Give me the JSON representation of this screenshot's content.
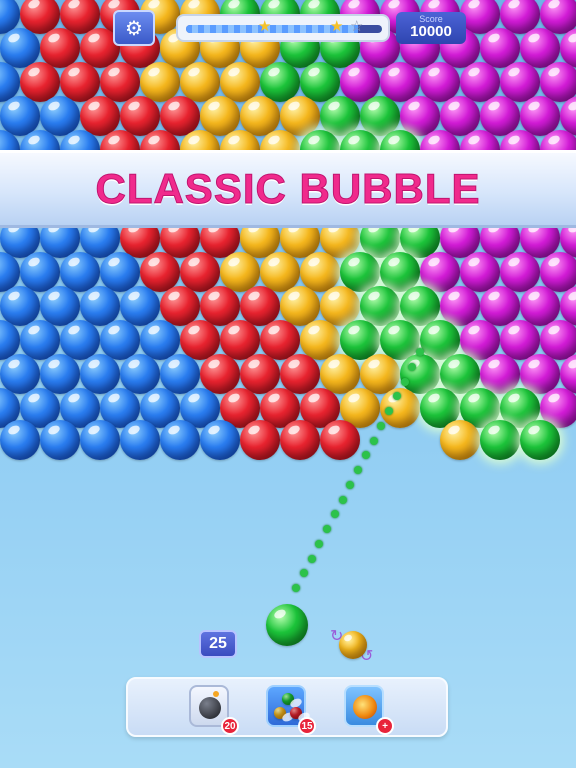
{
  "header": {
    "settings_icon": "gear-icon",
    "progress": {
      "fraction": 0.88,
      "stars_total": 3,
      "stars_earned": 2
    },
    "score": {
      "label": "Score",
      "value": "10000"
    }
  },
  "banner": {
    "title": "CLASSIC BUBBLE"
  },
  "shooter": {
    "current_color": "green",
    "next_color": "yellow",
    "moves_left": "25"
  },
  "powerups": [
    {
      "name": "bomb",
      "icon": "bomb-icon",
      "count": "20"
    },
    {
      "name": "color-swap",
      "icon": "multi-ball-icon",
      "count": "15"
    },
    {
      "name": "fireball",
      "icon": "fireball-icon",
      "count": "+"
    }
  ],
  "colors": {
    "blue": "#2a7df0",
    "red": "#e8232f",
    "yellow": "#f5b71d",
    "green": "#1cc43a",
    "purple": "#d21bd6",
    "banner_text": "#f02a8c"
  }
}
